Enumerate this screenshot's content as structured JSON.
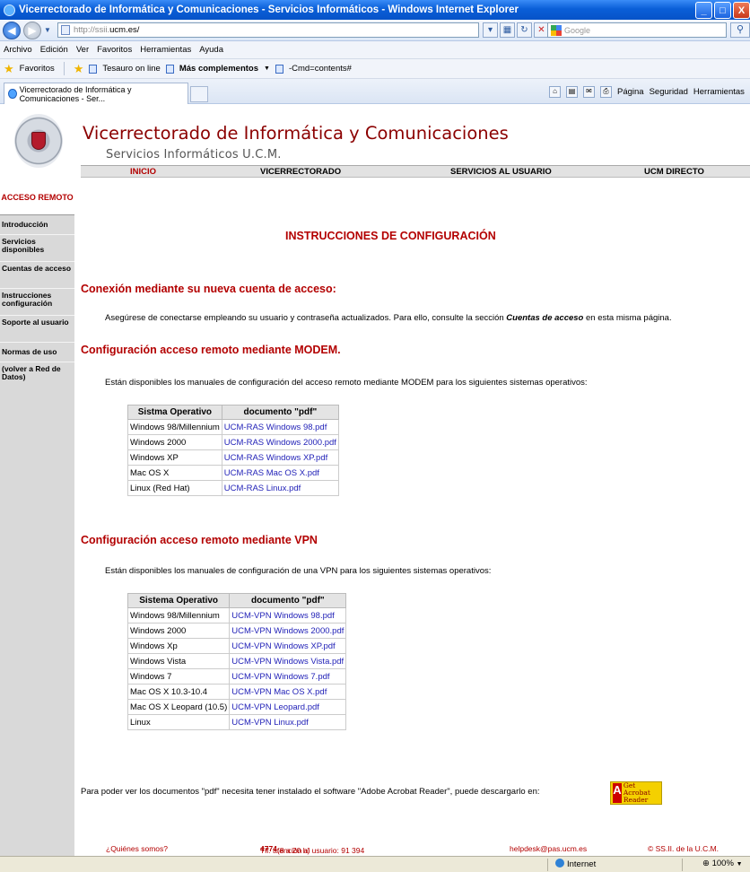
{
  "window": {
    "title": "Vicerrectorado de Informática y Comunicaciones - Servicios Informáticos - Windows Internet Explorer",
    "minimize": "_",
    "maximize": "□",
    "close": "X"
  },
  "address": {
    "url_prefix": "http://ssii.",
    "url_domain": "ucm.es/",
    "search_placeholder": "Google"
  },
  "menu": [
    "Archivo",
    "Edición",
    "Ver",
    "Favoritos",
    "Herramientas",
    "Ayuda"
  ],
  "favorites_bar": {
    "favorites": "Favoritos",
    "link1": "Tesauro on line",
    "link2": "Más complementos",
    "link3": "-Cmd=contents#"
  },
  "tab": {
    "title": "Vicerrectorado de Informática y Comunicaciones - Ser...",
    "pagina": "Página",
    "seguridad": "Seguridad",
    "herramientas": "Herramientas"
  },
  "site": {
    "title": "Vicerrectorado de Informática y Comunicaciones",
    "subtitle": "Servicios Informáticos U.C.M.",
    "nav": [
      "INICIO",
      "VICERRECTORADO",
      "SERVICIOS AL USUARIO",
      "UCM DIRECTO"
    ]
  },
  "sidebar": {
    "heading": "ACCESO REMOTO",
    "items": [
      {
        "label": "Introducción"
      },
      {
        "label": "Servicios disponibles"
      },
      {
        "label": "Cuentas de acceso"
      },
      {
        "label": "Instrucciones configuración"
      },
      {
        "label": "Soporte al usuario"
      },
      {
        "label": "Normas de uso"
      },
      {
        "label": "(volver a Red de Datos)"
      }
    ]
  },
  "main": {
    "title": "INSTRUCCIONES DE CONFIGURACIÓN",
    "sec1_title": "Conexión mediante su nueva cuenta de acceso:",
    "sec1_text_a": "Asegúrese de conectarse empleando su usuario y contraseña actualizados. Para ello, consulte la sección ",
    "sec1_text_link": "Cuentas de acceso",
    "sec1_text_b": " en esta misma página.",
    "sec2_title": "Configuración acceso remoto mediante MODEM.",
    "sec2_text": "Están disponibles los manuales de configuración del acceso remoto mediante MODEM para los siguientes sistemas operativos:",
    "modem_table": {
      "headers": [
        "Sistma Operativo",
        "documento \"pdf\""
      ],
      "rows": [
        [
          "Windows 98/Millennium",
          "UCM-RAS Windows 98.pdf"
        ],
        [
          "Windows 2000",
          "UCM-RAS Windows 2000.pdf"
        ],
        [
          "Windows XP",
          "UCM-RAS Windows XP.pdf"
        ],
        [
          "Mac OS X",
          "UCM-RAS Mac OS X.pdf"
        ],
        [
          "Linux (Red Hat)",
          "UCM-RAS Linux.pdf"
        ]
      ]
    },
    "sec3_title": "Configuración acceso remoto mediante VPN",
    "sec3_text": "Están disponibles los manuales de configuración de una VPN para los siguientes sistemas operativos:",
    "vpn_table": {
      "headers": [
        "Sistema Operativo",
        "documento \"pdf\""
      ],
      "rows": [
        [
          "Windows 98/Millennium",
          "UCM-VPN Windows 98.pdf"
        ],
        [
          "Windows 2000",
          "UCM-VPN Windows 2000.pdf"
        ],
        [
          "Windows Xp",
          "UCM-VPN Windows XP.pdf"
        ],
        [
          "Windows Vista",
          "UCM-VPN Windows Vista.pdf"
        ],
        [
          "Windows 7",
          "UCM-VPN Windows 7.pdf"
        ],
        [
          "Mac OS X 10.3-10.4",
          "UCM-VPN Mac OS X.pdf"
        ],
        [
          "Mac OS X Leopard (10.5)",
          "UCM-VPN Leopard.pdf"
        ],
        [
          "Linux",
          "UCM-VPN Linux.pdf"
        ]
      ]
    },
    "pdf_note": "Para poder ver los documentos \"pdf\" necesita tener instalado el software \"Adobe Acrobat Reader\", puede descargarlo en:",
    "acrobat_get": "Get",
    "acrobat_name": "Acrobat Reader"
  },
  "footer": {
    "who": "¿Quiénes somos?",
    "phone_a": "Tlf. atención al usuario: 91 394 ",
    "phone_b": "4774",
    "phone_c": " (8 a 20 h)",
    "email": "helpdesk@pas.ucm.es",
    "copyright": "© SS.II. de la U.C.M."
  },
  "status": {
    "zone": "Internet",
    "zoom": "100%"
  }
}
